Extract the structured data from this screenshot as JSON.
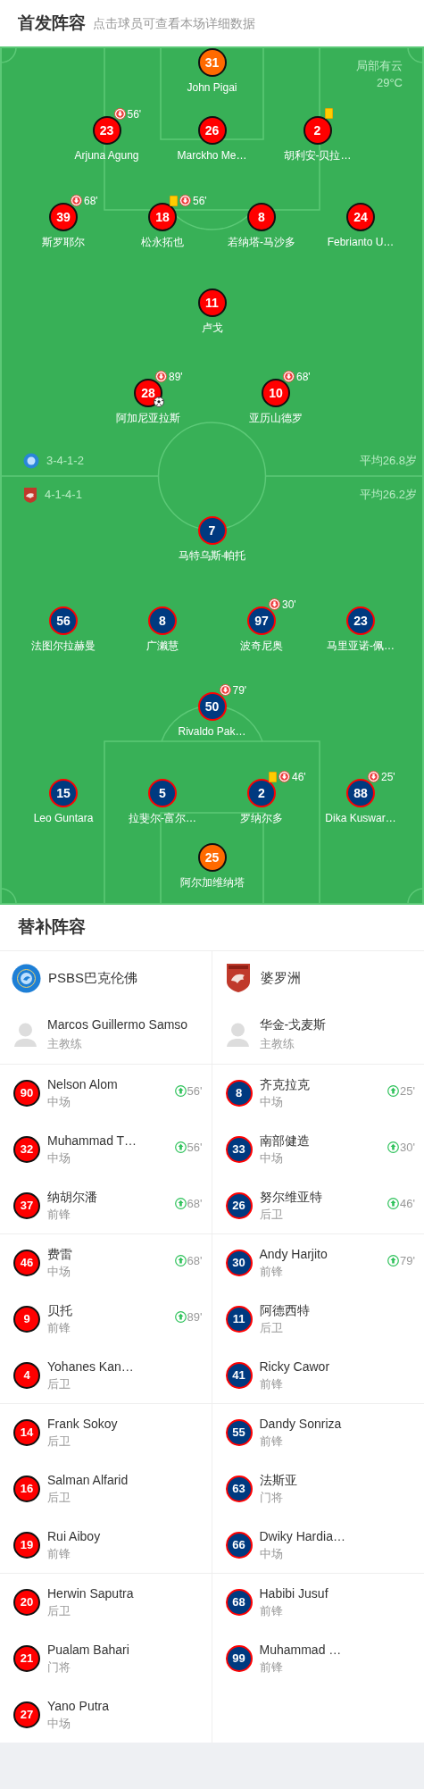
{
  "header": {
    "title": "首发阵容",
    "subtitle": "点击球员可查看本场详细数据"
  },
  "pitch": {
    "weather": {
      "condition": "局部有云",
      "temperature": "29°C"
    },
    "teams": [
      {
        "kind": "home",
        "formation": "3-4-1-2",
        "average_age": "平均26.8岁",
        "rows": [
          [
            {
              "number": "31",
              "name": "John Pigai",
              "kind": "goalkeeper",
              "yellow_card": false,
              "goal": false
            }
          ],
          [
            {
              "number": "23",
              "name": "Arjuna Agung",
              "kind": "outfield",
              "yellow_card": false,
              "goal": false,
              "subbed_off": "56'"
            },
            {
              "number": "26",
              "name": "Marckho Me…",
              "kind": "outfield",
              "yellow_card": false,
              "goal": false
            },
            {
              "number": "2",
              "name": "胡利安-贝拉…",
              "kind": "outfield",
              "yellow_card": true,
              "goal": false
            }
          ],
          [
            {
              "number": "39",
              "name": "斯罗耶尔",
              "kind": "outfield",
              "yellow_card": false,
              "goal": false,
              "subbed_off": "68'"
            },
            {
              "number": "18",
              "name": "松永拓也",
              "kind": "outfield",
              "yellow_card": true,
              "goal": false,
              "subbed_off": "56'"
            },
            {
              "number": "8",
              "name": "若纳塔-马沙多",
              "kind": "outfield",
              "yellow_card": false,
              "goal": false
            },
            {
              "number": "24",
              "name": "Febrianto U…",
              "kind": "outfield",
              "yellow_card": false,
              "goal": false
            }
          ],
          [
            {
              "number": "11",
              "name": "卢戈",
              "kind": "outfield",
              "yellow_card": false,
              "goal": false
            }
          ],
          [
            {
              "number": "28",
              "name": "阿加尼亚拉斯",
              "kind": "outfield",
              "yellow_card": false,
              "goal": true,
              "subbed_off": "89'"
            },
            {
              "number": "10",
              "name": "亚历山德罗",
              "kind": "outfield",
              "yellow_card": false,
              "goal": false,
              "subbed_off": "68'"
            }
          ]
        ]
      },
      {
        "kind": "away",
        "formation": "4-1-4-1",
        "average_age": "平均26.2岁",
        "rows": [
          [
            {
              "number": "7",
              "name": "马特乌斯-帕托",
              "kind": "outfield",
              "yellow_card": false,
              "goal": false
            }
          ],
          [
            {
              "number": "56",
              "name": "法图尔拉赫曼",
              "kind": "outfield",
              "yellow_card": false,
              "goal": false
            },
            {
              "number": "8",
              "name": "广濑慧",
              "kind": "outfield",
              "yellow_card": false,
              "goal": false
            },
            {
              "number": "97",
              "name": "波奇尼奥",
              "kind": "outfield",
              "yellow_card": false,
              "goal": false,
              "subbed_off": "30'"
            },
            {
              "number": "23",
              "name": "马里亚诺-佩…",
              "kind": "outfield",
              "yellow_card": false,
              "goal": false
            }
          ],
          [
            {
              "number": "50",
              "name": "Rivaldo Pak…",
              "kind": "outfield",
              "yellow_card": false,
              "goal": false,
              "subbed_off": "79'"
            }
          ],
          [
            {
              "number": "15",
              "name": "Leo Guntara",
              "kind": "outfield",
              "yellow_card": false,
              "goal": false
            },
            {
              "number": "5",
              "name": "拉斐尔-富尔…",
              "kind": "outfield",
              "yellow_card": false,
              "goal": false
            },
            {
              "number": "2",
              "name": "罗纳尔多",
              "kind": "outfield",
              "yellow_card": true,
              "goal": false,
              "subbed_off": "46'"
            },
            {
              "number": "88",
              "name": "Dika Kuswar…",
              "kind": "outfield",
              "yellow_card": false,
              "goal": false,
              "subbed_off": "25'"
            }
          ],
          [
            {
              "number": "25",
              "name": "阿尔加维纳塔",
              "kind": "goalkeeper",
              "yellow_card": false,
              "goal": false
            }
          ]
        ]
      }
    ]
  },
  "substitutes": {
    "title": "替补阵容",
    "teams": [
      {
        "kind": "home",
        "name": "PSBS巴克伦佛",
        "coach": {
          "name": "Marcos Guillermo Samso",
          "role": "主教练"
        },
        "players": [
          {
            "number": "90",
            "name": "Nelson Alom",
            "position": "中场",
            "subbed_on": "56'"
          },
          {
            "number": "32",
            "name": "Muhammad T…",
            "position": "中场",
            "subbed_on": "56'"
          },
          {
            "number": "37",
            "name": "纳胡尔潘",
            "position": "前锋",
            "subbed_on": "68'"
          },
          {
            "number": "46",
            "name": "费雷",
            "position": "中场",
            "subbed_on": "68'"
          },
          {
            "number": "9",
            "name": "贝托",
            "position": "前锋",
            "subbed_on": "89'"
          },
          {
            "number": "4",
            "name": "Yohanes Kan…",
            "position": "后卫"
          },
          {
            "number": "14",
            "name": "Frank Sokoy",
            "position": "后卫"
          },
          {
            "number": "16",
            "name": "Salman Alfarid",
            "position": "后卫"
          },
          {
            "number": "19",
            "name": "Rui Aiboy",
            "position": "前锋"
          },
          {
            "number": "20",
            "name": "Herwin Saputra",
            "position": "后卫"
          },
          {
            "number": "21",
            "name": "Pualam Bahari",
            "position": "门将"
          },
          {
            "number": "27",
            "name": "Yano Putra",
            "position": "中场"
          }
        ]
      },
      {
        "kind": "away",
        "name": "婆罗洲",
        "coach": {
          "name": "华金-戈麦斯",
          "role": "主教练"
        },
        "players": [
          {
            "number": "8",
            "name": "齐克拉克",
            "position": "中场",
            "subbed_on": "25'"
          },
          {
            "number": "33",
            "name": "南部健造",
            "position": "中场",
            "subbed_on": "30'"
          },
          {
            "number": "26",
            "name": "努尔维亚特",
            "position": "后卫",
            "subbed_on": "46'"
          },
          {
            "number": "30",
            "name": "Andy Harjito",
            "position": "前锋",
            "subbed_on": "79'"
          },
          {
            "number": "11",
            "name": "阿德西特",
            "position": "后卫"
          },
          {
            "number": "41",
            "name": "Ricky Cawor",
            "position": "前锋"
          },
          {
            "number": "55",
            "name": "Dandy Sonriza",
            "position": "前锋"
          },
          {
            "number": "63",
            "name": "法斯亚",
            "position": "门将"
          },
          {
            "number": "66",
            "name": "Dwiky Hardia…",
            "position": "中场"
          },
          {
            "number": "68",
            "name": "Habibi Jusuf",
            "position": "前锋"
          },
          {
            "number": "99",
            "name": "Muhammad …",
            "position": "前锋"
          }
        ]
      }
    ]
  }
}
